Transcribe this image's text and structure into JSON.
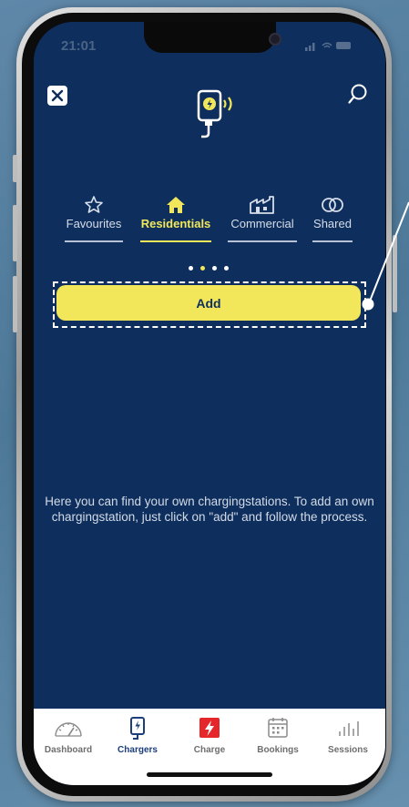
{
  "status_bar": {
    "time": "21:01"
  },
  "header": {
    "close_icon": "close-icon",
    "search_icon": "search-icon",
    "logo_icon": "charger-card-icon"
  },
  "tabs": [
    {
      "label": "Favourites",
      "icon": "star-icon",
      "active": false
    },
    {
      "label": "Residentials",
      "icon": "house-icon",
      "active": true
    },
    {
      "label": "Commercial",
      "icon": "factory-icon",
      "active": false
    },
    {
      "label": "Shared",
      "icon": "rings-icon",
      "active": false
    }
  ],
  "pager": {
    "count": 4,
    "active_index": 1
  },
  "add_button": {
    "label": "Add"
  },
  "info_text": "Here you can find your own chargingstations. To add an own chargingstation, just click on \"add\" and follow the process.",
  "bottom_nav": [
    {
      "label": "Dashboard",
      "icon": "gauge-icon",
      "active": false
    },
    {
      "label": "Chargers",
      "icon": "charger-icon",
      "active": true
    },
    {
      "label": "Charge",
      "icon": "lightning-icon",
      "active": false
    },
    {
      "label": "Bookings",
      "icon": "calendar-icon",
      "active": false
    },
    {
      "label": "Sessions",
      "icon": "bar-chart-icon",
      "active": false
    }
  ],
  "colors": {
    "background": "#0e2f5d",
    "accent": "#f2e75a",
    "nav_active": "#1b3f7a",
    "charge_red": "#e5262a"
  }
}
